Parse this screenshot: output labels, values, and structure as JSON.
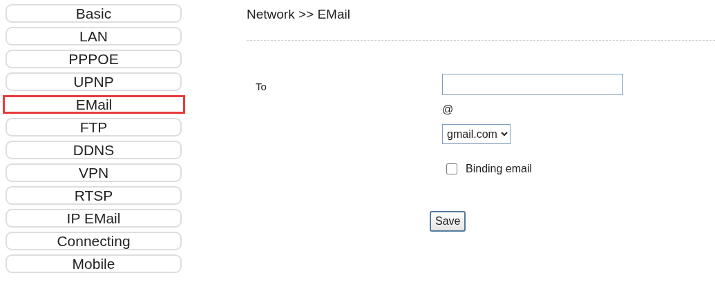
{
  "sidebar": {
    "items": [
      {
        "label": "Basic",
        "selected": false
      },
      {
        "label": "LAN",
        "selected": false
      },
      {
        "label": "PPPOE",
        "selected": false
      },
      {
        "label": "UPNP",
        "selected": false
      },
      {
        "label": "EMail",
        "selected": true
      },
      {
        "label": "FTP",
        "selected": false
      },
      {
        "label": "DDNS",
        "selected": false
      },
      {
        "label": "VPN",
        "selected": false
      },
      {
        "label": "RTSP",
        "selected": false
      },
      {
        "label": "IP EMail",
        "selected": false
      },
      {
        "label": "Connecting",
        "selected": false
      },
      {
        "label": "Mobile",
        "selected": false
      }
    ]
  },
  "breadcrumb": "Network >> EMail",
  "form": {
    "to_label": "To",
    "at": "@",
    "domain": "gmail.com",
    "binding": {
      "label": "Binding email",
      "checked": false
    },
    "save": "Save"
  }
}
